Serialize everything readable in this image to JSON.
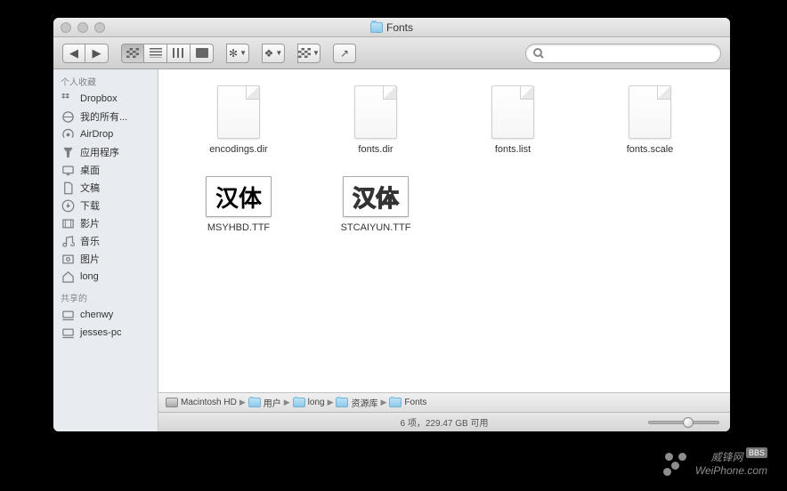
{
  "window": {
    "title": "Fonts"
  },
  "search": {
    "placeholder": ""
  },
  "sidebar": {
    "section_fav": "个人收藏",
    "section_shared": "共享的",
    "favorites": [
      {
        "label": "Dropbox",
        "icon": "dropbox"
      },
      {
        "label": "我的所有...",
        "icon": "all-files"
      },
      {
        "label": "AirDrop",
        "icon": "airdrop"
      },
      {
        "label": "应用程序",
        "icon": "applications"
      },
      {
        "label": "桌面",
        "icon": "desktop"
      },
      {
        "label": "文稿",
        "icon": "documents"
      },
      {
        "label": "下载",
        "icon": "downloads"
      },
      {
        "label": "影片",
        "icon": "movies"
      },
      {
        "label": "音乐",
        "icon": "music"
      },
      {
        "label": "图片",
        "icon": "pictures"
      },
      {
        "label": "long",
        "icon": "home"
      }
    ],
    "shared": [
      {
        "label": "chenwy",
        "icon": "computer"
      },
      {
        "label": "jesses-pc",
        "icon": "computer"
      }
    ]
  },
  "files": [
    {
      "name": "encodings.dir",
      "kind": "doc"
    },
    {
      "name": "fonts.dir",
      "kind": "doc"
    },
    {
      "name": "fonts.list",
      "kind": "doc"
    },
    {
      "name": "fonts.scale",
      "kind": "doc"
    },
    {
      "name": "MSYHBD.TTF",
      "kind": "font-solid",
      "preview": "汉体"
    },
    {
      "name": "STCAIYUN.TTF",
      "kind": "font-outline",
      "preview": "汉体"
    }
  ],
  "path": [
    {
      "label": "Macintosh HD",
      "icon": "hd"
    },
    {
      "label": "用户",
      "icon": "folder"
    },
    {
      "label": "long",
      "icon": "folder"
    },
    {
      "label": "资源库",
      "icon": "folder"
    },
    {
      "label": "Fonts",
      "icon": "folder"
    }
  ],
  "status": "6 项，229.47 GB 可用",
  "watermark": {
    "text1": "威锋网",
    "badge": "BBS",
    "text2": "WeiPhone.com"
  }
}
